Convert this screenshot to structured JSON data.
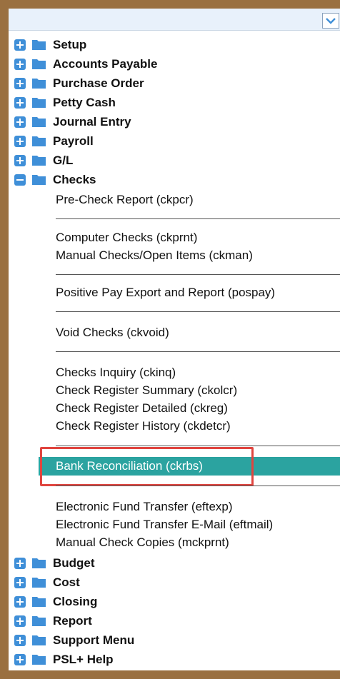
{
  "menu": {
    "top_nodes": [
      {
        "label": "Setup"
      },
      {
        "label": "Accounts Payable"
      },
      {
        "label": "Purchase Order"
      },
      {
        "label": "Petty Cash"
      },
      {
        "label": "Journal Entry"
      },
      {
        "label": "Payroll"
      },
      {
        "label": "G/L"
      }
    ],
    "checks": {
      "label": "Checks",
      "items": [
        "Pre-Check Report (ckpcr)",
        "Computer Checks (ckprnt)",
        "Manual Checks/Open Items (ckman)",
        "Positive Pay Export and Report (pospay)",
        "Void Checks (ckvoid)",
        "Checks Inquiry (ckinq)",
        "Check Register Summary (ckolcr)",
        "Check Register Detailed (ckreg)",
        "Check Register History (ckdetcr)",
        "Bank Reconciliation (ckrbs)",
        "Electronic Fund Transfer (eftexp)",
        "Electronic Fund Transfer E-Mail (eftmail)",
        "Manual Check Copies (mckprnt)"
      ],
      "selected_item": "Bank Reconciliation (ckrbs)"
    },
    "bottom_nodes": [
      {
        "label": "Budget"
      },
      {
        "label": "Cost"
      },
      {
        "label": "Closing"
      },
      {
        "label": "Report"
      },
      {
        "label": "Support Menu"
      },
      {
        "label": "PSL+ Help"
      }
    ]
  },
  "icons": {
    "dropdown": "chevron-down-icon",
    "expand": "plus-box-icon",
    "collapse": "minus-box-icon",
    "folder": "folder-icon"
  },
  "colors": {
    "frame": "#9a7040",
    "selection": "#2ba3a0",
    "highlight_box": "#e0453f",
    "expander": "#3f8fd8",
    "folder": "#3f8fd8"
  }
}
